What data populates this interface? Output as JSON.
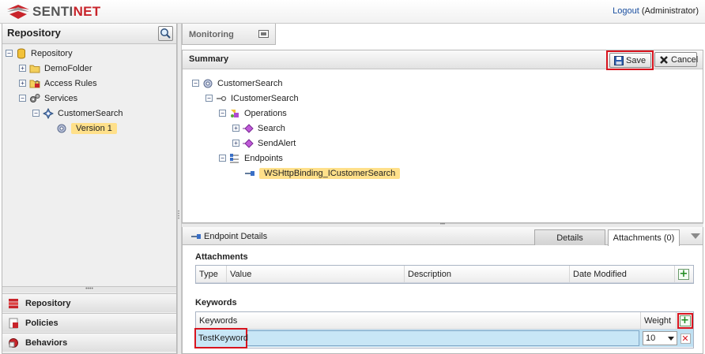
{
  "app": {
    "brand_prefix": "SENTI",
    "brand_suffix": "NET"
  },
  "user": {
    "logout_label": "Logout",
    "role": "(Administrator)"
  },
  "repository_panel": {
    "title": "Repository",
    "tree": {
      "root": "Repository",
      "demo_folder": "DemoFolder",
      "access_rules": "Access Rules",
      "services": "Services",
      "customer_search": "CustomerSearch",
      "version": "Version 1"
    }
  },
  "nav": {
    "repository": "Repository",
    "policies": "Policies",
    "behaviors": "Behaviors"
  },
  "main_tab": {
    "label": "Monitoring"
  },
  "summary": {
    "title": "Summary",
    "save_label": "Save",
    "cancel_label": "Cancel",
    "tree": {
      "service": "CustomerSearch",
      "interface": "ICustomerSearch",
      "operations": "Operations",
      "op_search": "Search",
      "op_sendalert": "SendAlert",
      "endpoints": "Endpoints",
      "endpoint": "WSHttpBinding_ICustomerSearch"
    }
  },
  "details": {
    "title": "Endpoint Details",
    "tab_details": "Details",
    "tab_attachments": "Attachments (0)",
    "attachments_label": "Attachments",
    "attachments_columns": [
      "Type",
      "Value",
      "Description",
      "Date Modified"
    ],
    "keywords_label": "Keywords",
    "keywords_columns": [
      "Keywords",
      "Weight"
    ],
    "keyword_rows": [
      {
        "keyword": "TestKeyword",
        "weight": "10"
      }
    ]
  },
  "colors": {
    "highlight": "#d8141e",
    "selection": "#ffe08a",
    "brand_red": "#c8242b"
  }
}
